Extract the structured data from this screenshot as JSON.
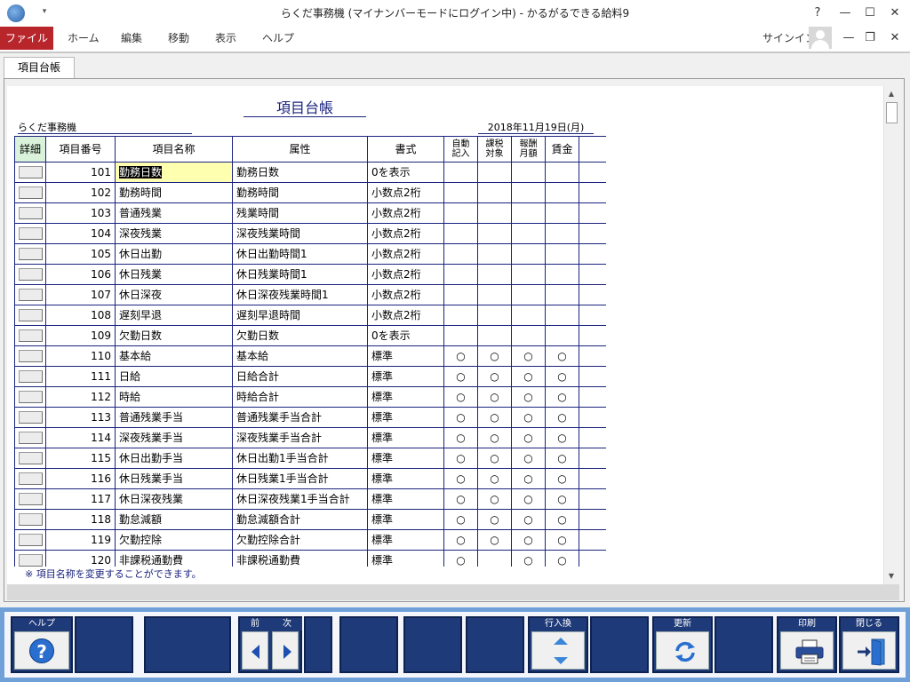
{
  "window": {
    "title": "らくだ事務機 (マイナンバーモードにログイン中) - かるがるできる給料9",
    "qa_glyph": "▾",
    "help_glyph": "?",
    "minimize_glyph": "—",
    "maximize_glyph": "☐",
    "close_glyph": "✕",
    "restore_glyph": "❐",
    "ribbon_close_glyph": "✕"
  },
  "ribbon": {
    "tabs": [
      "ファイル",
      "ホーム",
      "編集",
      "移動",
      "表示",
      "ヘルプ"
    ],
    "signin": "サインイン"
  },
  "doc_tab": "項目台帳",
  "report": {
    "title": "項目台帳",
    "company": "らくだ事務機",
    "date": "2018年11月19日(月)"
  },
  "table": {
    "headers": {
      "detail": "詳細",
      "number": "項目番号",
      "name": "項目名称",
      "attribute": "属性",
      "format": "書式",
      "auto_entry": "自動記入",
      "taxable": "課税対象",
      "monthly_pay": "報酬月額",
      "wage": "賃金"
    },
    "rows": [
      {
        "no": "101",
        "name": "勤務日数",
        "attr": "勤務日数",
        "fmt": "0を表示",
        "a": "",
        "t": "",
        "m": "",
        "w": ""
      },
      {
        "no": "102",
        "name": "勤務時間",
        "attr": "勤務時間",
        "fmt": "小数点2桁",
        "a": "",
        "t": "",
        "m": "",
        "w": ""
      },
      {
        "no": "103",
        "name": "普通残業",
        "attr": "残業時間",
        "fmt": "小数点2桁",
        "a": "",
        "t": "",
        "m": "",
        "w": ""
      },
      {
        "no": "104",
        "name": "深夜残業",
        "attr": "深夜残業時間",
        "fmt": "小数点2桁",
        "a": "",
        "t": "",
        "m": "",
        "w": ""
      },
      {
        "no": "105",
        "name": "休日出勤",
        "attr": "休日出勤時間1",
        "fmt": "小数点2桁",
        "a": "",
        "t": "",
        "m": "",
        "w": ""
      },
      {
        "no": "106",
        "name": "休日残業",
        "attr": "休日残業時間1",
        "fmt": "小数点2桁",
        "a": "",
        "t": "",
        "m": "",
        "w": ""
      },
      {
        "no": "107",
        "name": "休日深夜",
        "attr": "休日深夜残業時間1",
        "fmt": "小数点2桁",
        "a": "",
        "t": "",
        "m": "",
        "w": ""
      },
      {
        "no": "108",
        "name": "遅刻早退",
        "attr": "遅刻早退時間",
        "fmt": "小数点2桁",
        "a": "",
        "t": "",
        "m": "",
        "w": ""
      },
      {
        "no": "109",
        "name": "欠勤日数",
        "attr": "欠勤日数",
        "fmt": "0を表示",
        "a": "",
        "t": "",
        "m": "",
        "w": ""
      },
      {
        "no": "110",
        "name": "基本給",
        "attr": "基本給",
        "fmt": "標準",
        "a": "○",
        "t": "○",
        "m": "○",
        "w": "○"
      },
      {
        "no": "111",
        "name": "日給",
        "attr": "日給合計",
        "fmt": "標準",
        "a": "○",
        "t": "○",
        "m": "○",
        "w": "○"
      },
      {
        "no": "112",
        "name": "時給",
        "attr": "時給合計",
        "fmt": "標準",
        "a": "○",
        "t": "○",
        "m": "○",
        "w": "○"
      },
      {
        "no": "113",
        "name": "普通残業手当",
        "attr": "普通残業手当合計",
        "fmt": "標準",
        "a": "○",
        "t": "○",
        "m": "○",
        "w": "○"
      },
      {
        "no": "114",
        "name": "深夜残業手当",
        "attr": "深夜残業手当合計",
        "fmt": "標準",
        "a": "○",
        "t": "○",
        "m": "○",
        "w": "○"
      },
      {
        "no": "115",
        "name": "休日出勤手当",
        "attr": "休日出勤1手当合計",
        "fmt": "標準",
        "a": "○",
        "t": "○",
        "m": "○",
        "w": "○"
      },
      {
        "no": "116",
        "name": "休日残業手当",
        "attr": "休日残業1手当合計",
        "fmt": "標準",
        "a": "○",
        "t": "○",
        "m": "○",
        "w": "○"
      },
      {
        "no": "117",
        "name": "休日深夜残業",
        "attr": "休日深夜残業1手当合計",
        "fmt": "標準",
        "a": "○",
        "t": "○",
        "m": "○",
        "w": "○"
      },
      {
        "no": "118",
        "name": "勤怠減額",
        "attr": "勤怠減額合計",
        "fmt": "標準",
        "a": "○",
        "t": "○",
        "m": "○",
        "w": "○"
      },
      {
        "no": "119",
        "name": "欠勤控除",
        "attr": "欠勤控除合計",
        "fmt": "標準",
        "a": "○",
        "t": "○",
        "m": "○",
        "w": "○"
      },
      {
        "no": "120",
        "name": "非課税通勤費",
        "attr": "非課税通勤費",
        "fmt": "標準",
        "a": "○",
        "t": "",
        "m": "○",
        "w": "○"
      }
    ]
  },
  "note": "※ 項目名称を変更することができます。",
  "toolbar": {
    "help": "ヘルプ",
    "prev": "前",
    "next": "次",
    "row_swap": "行入換",
    "refresh": "更新",
    "print": "印刷",
    "close": "閉じる"
  },
  "colors": {
    "accent_file_tab": "#b8262c",
    "grid_line": "#1a237e",
    "toolbar_bg": "#6fa0d8",
    "toolbar_button": "#1e3a78",
    "highlight": "#ffffb0"
  }
}
